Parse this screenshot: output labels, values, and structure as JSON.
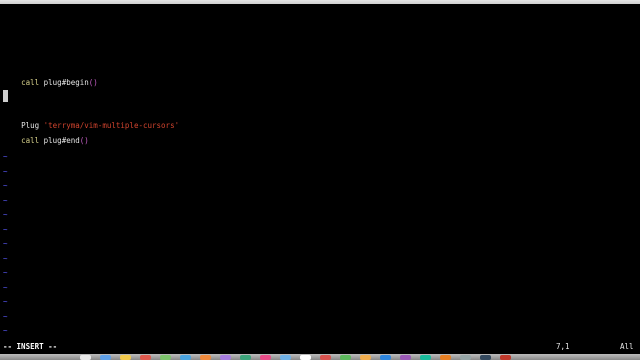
{
  "editor": {
    "line1": {
      "keyword": "call",
      "func": "plug#begin",
      "parens": "()"
    },
    "line3": {
      "keyword": "Plug",
      "string": "'terryma/vim-multiple-cursors'"
    },
    "line4": {
      "keyword": "call",
      "func": "plug#end",
      "parens": "()"
    },
    "tilde": "~"
  },
  "statusline": {
    "mode": "-- INSERT --",
    "position": "7,1",
    "scroll": "All"
  },
  "colors": {
    "background": "#000000",
    "keyword": "#d6d08a",
    "paren": "#c65fc6",
    "string": "#d1442e",
    "tilde": "#5b5bff"
  }
}
